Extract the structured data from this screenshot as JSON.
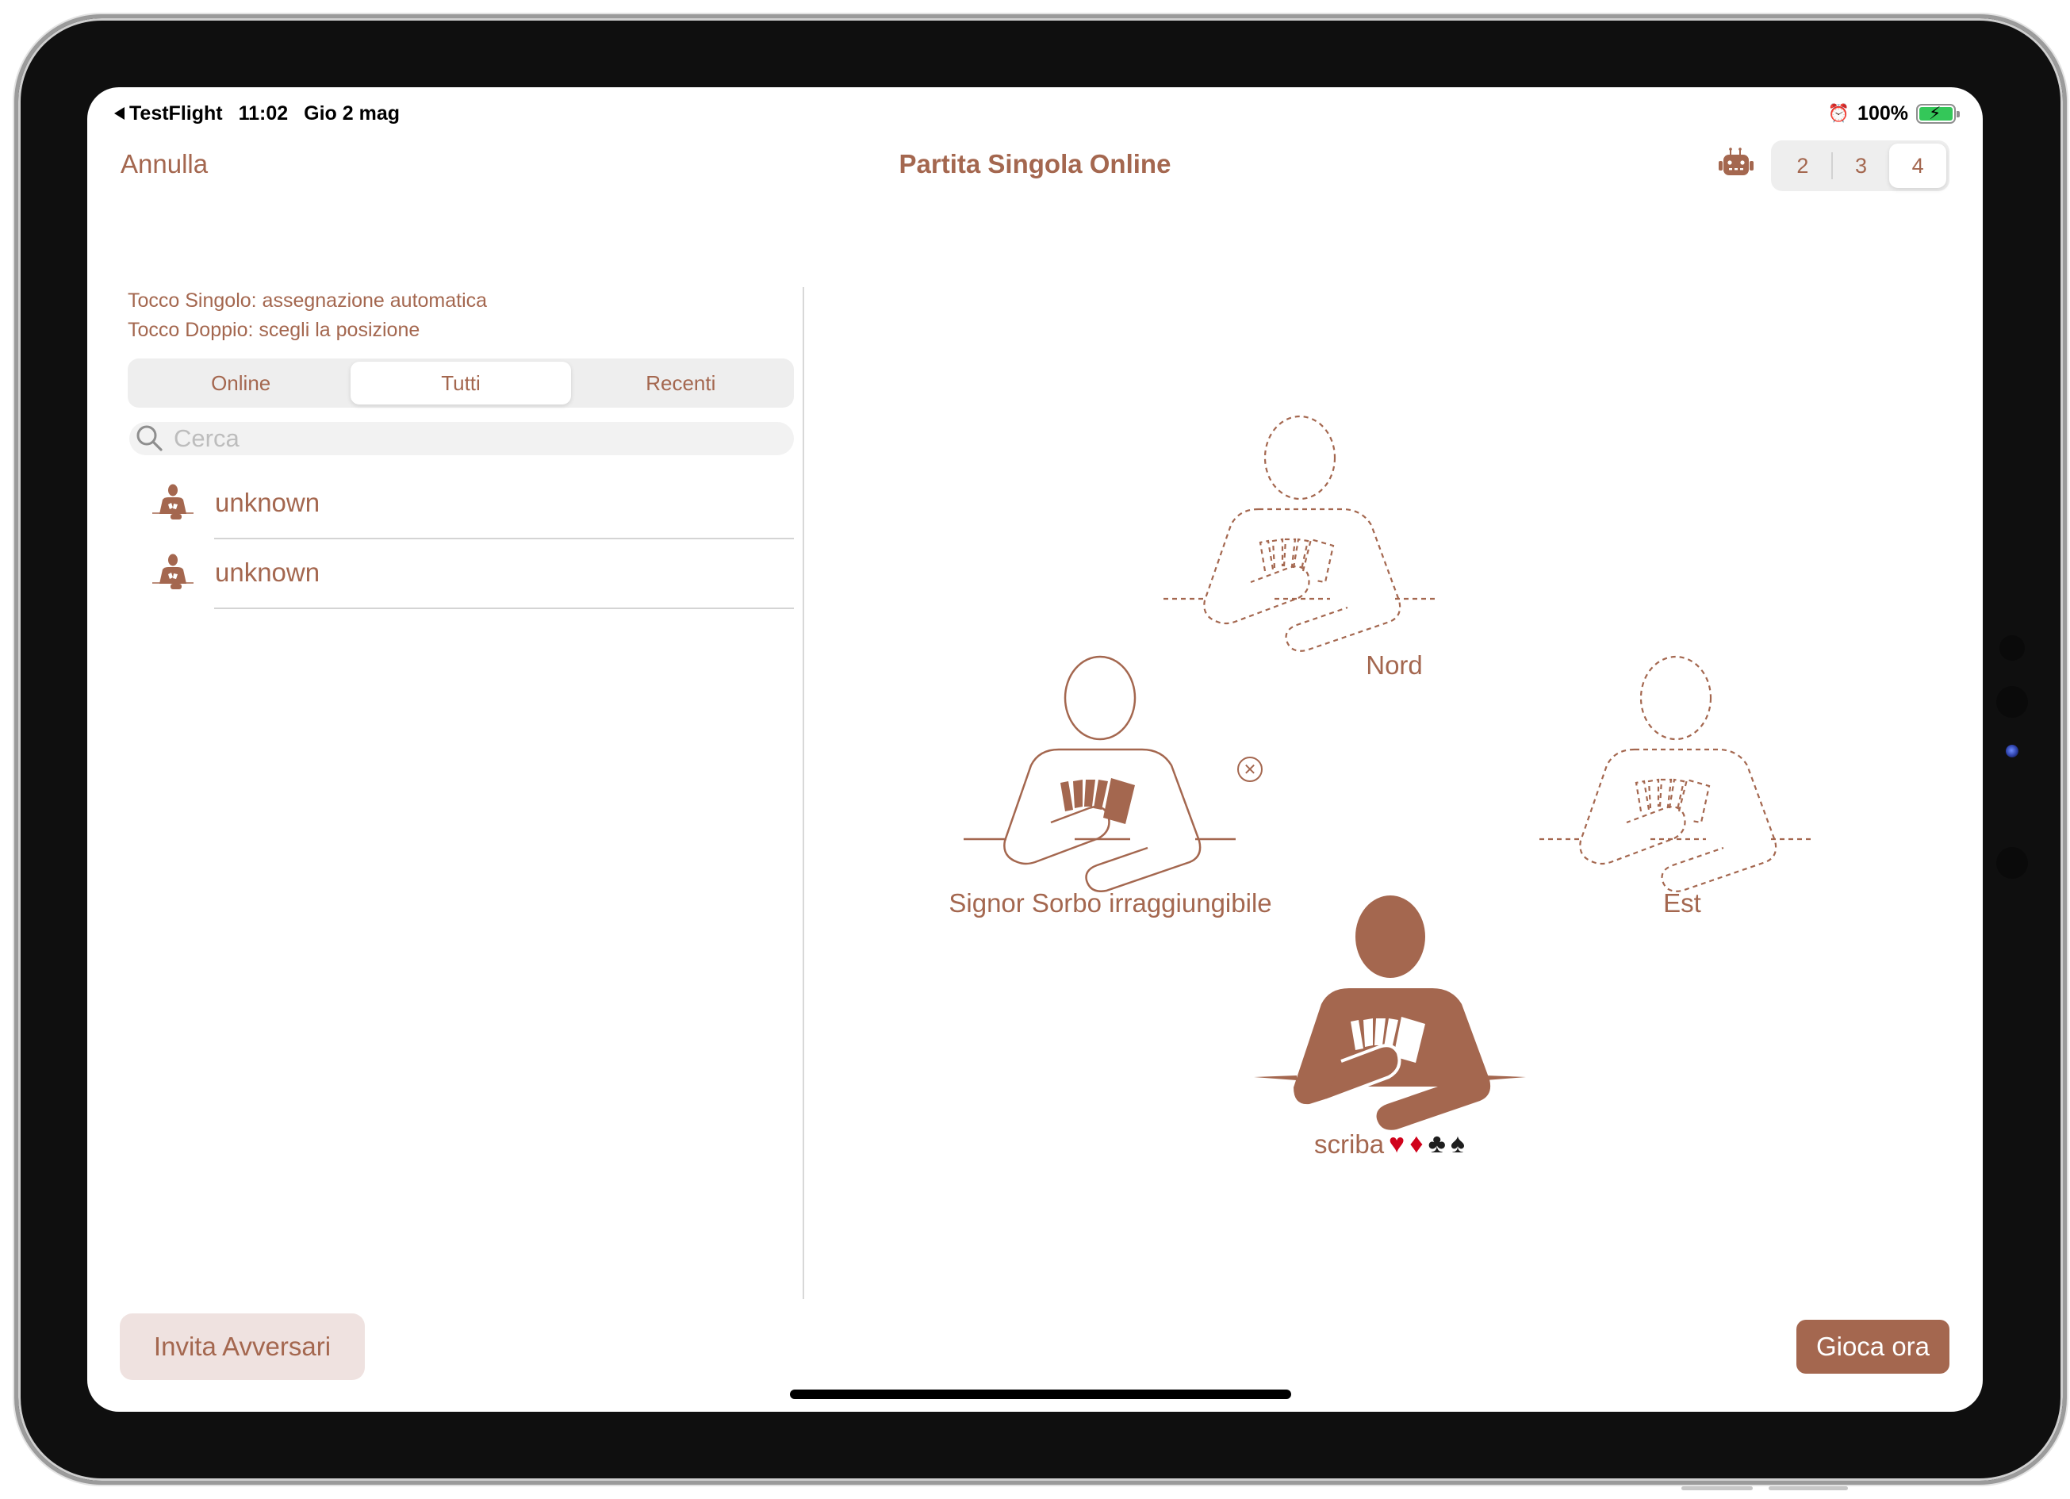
{
  "status_bar": {
    "back_app": "TestFlight",
    "time": "11:02",
    "date": "Gio 2 mag",
    "battery": "100%",
    "battery_level": 1.0,
    "alarm_icon": "alarm-clock-icon",
    "battery_icon": "battery-charging-icon"
  },
  "nav": {
    "cancel_label": "Annulla",
    "title": "Partita Singola Online",
    "robot_icon": "robot-icon",
    "player_count_options": [
      "2",
      "3",
      "4"
    ],
    "player_count_selected": "4"
  },
  "left_panel": {
    "hint_single": "Tocco Singolo: assegnazione automatica",
    "hint_double": "Tocco Doppio: scegli la posizione",
    "tabs": [
      {
        "label": "Online",
        "selected": false
      },
      {
        "label": "Tutti",
        "selected": true
      },
      {
        "label": "Recenti",
        "selected": false
      }
    ],
    "search_placeholder": "Cerca",
    "search_value": "",
    "players": [
      {
        "name": "unknown",
        "icon": "card-player-icon"
      },
      {
        "name": "unknown",
        "icon": "card-player-icon"
      }
    ]
  },
  "table": {
    "seats": [
      {
        "position": "north",
        "label": "Nord",
        "state": "empty"
      },
      {
        "position": "west",
        "label": "Signor Sorbo irraggiungibile",
        "state": "assigned-unreachable",
        "removable": true
      },
      {
        "position": "east",
        "label": "Est",
        "state": "empty"
      },
      {
        "position": "south",
        "label": "scriba",
        "state": "self",
        "suits": [
          "♥",
          "♦",
          "♣",
          "♠"
        ]
      }
    ],
    "remove_icon": "close-circle-icon"
  },
  "actions": {
    "invite_label": "Invita Avversari",
    "play_label": "Gioca ora"
  },
  "colors": {
    "accent": "#a4674f",
    "invite_bg": "#efe2e0",
    "segment_bg": "#eeeeee",
    "battery_green": "#34c759"
  }
}
